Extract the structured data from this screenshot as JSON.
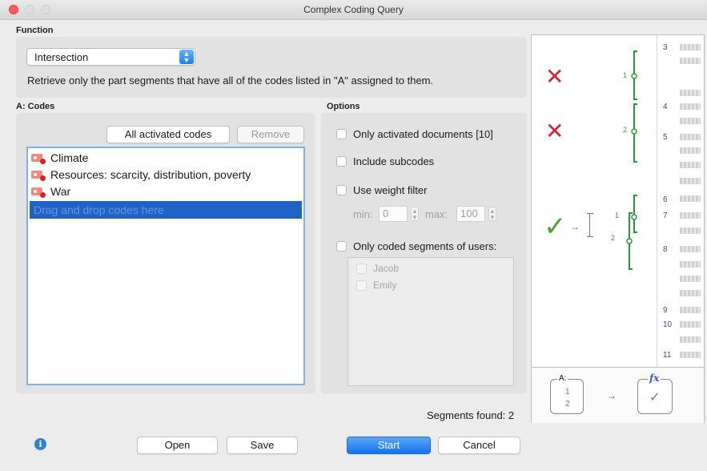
{
  "window": {
    "title": "Complex Coding Query"
  },
  "function": {
    "section_label": "Function",
    "selected": "Intersection",
    "description": "Retrieve only the part segments that have all of the codes listed in \"A\" assigned to them."
  },
  "codes": {
    "section_label": "A: Codes",
    "all_activated_label": "All activated codes",
    "remove_label": "Remove",
    "items": [
      {
        "label": "Climate"
      },
      {
        "label": "Resources: scarcity, distribution, poverty"
      },
      {
        "label": "War"
      }
    ],
    "drop_placeholder": "Drag and drop codes here"
  },
  "options": {
    "section_label": "Options",
    "only_activated_docs": "Only activated documents [10]",
    "include_subcodes": "Include subcodes",
    "use_weight_filter": "Use weight filter",
    "min_label": "min:",
    "min_value": "0",
    "max_label": "max:",
    "max_value": "100",
    "only_coded_users": "Only coded segments of users:",
    "users": [
      {
        "name": "Jacob"
      },
      {
        "name": "Emily"
      }
    ]
  },
  "results": {
    "segments_found": "Segments found: 2"
  },
  "footer": {
    "open_label": "Open",
    "save_label": "Save",
    "start_label": "Start",
    "cancel_label": "Cancel"
  },
  "illustration": {
    "line_numbers": [
      "3",
      "4",
      "5",
      "6",
      "7",
      "8",
      "9",
      "10",
      "11"
    ],
    "bracket_labels": [
      "1",
      "2",
      "1",
      "2"
    ],
    "legend_a_label": "A:",
    "legend_a_values": [
      "1",
      "2"
    ],
    "legend_fx_label": "fx"
  },
  "colors": {
    "accent": "#1c7cf4",
    "selection": "#1f62c8",
    "cross": "#d8213a",
    "check": "#4aa13a"
  },
  "icons": [
    "info-icon",
    "code-tag-icon",
    "cross-icon",
    "checkmark-icon",
    "arrow-icon"
  ]
}
